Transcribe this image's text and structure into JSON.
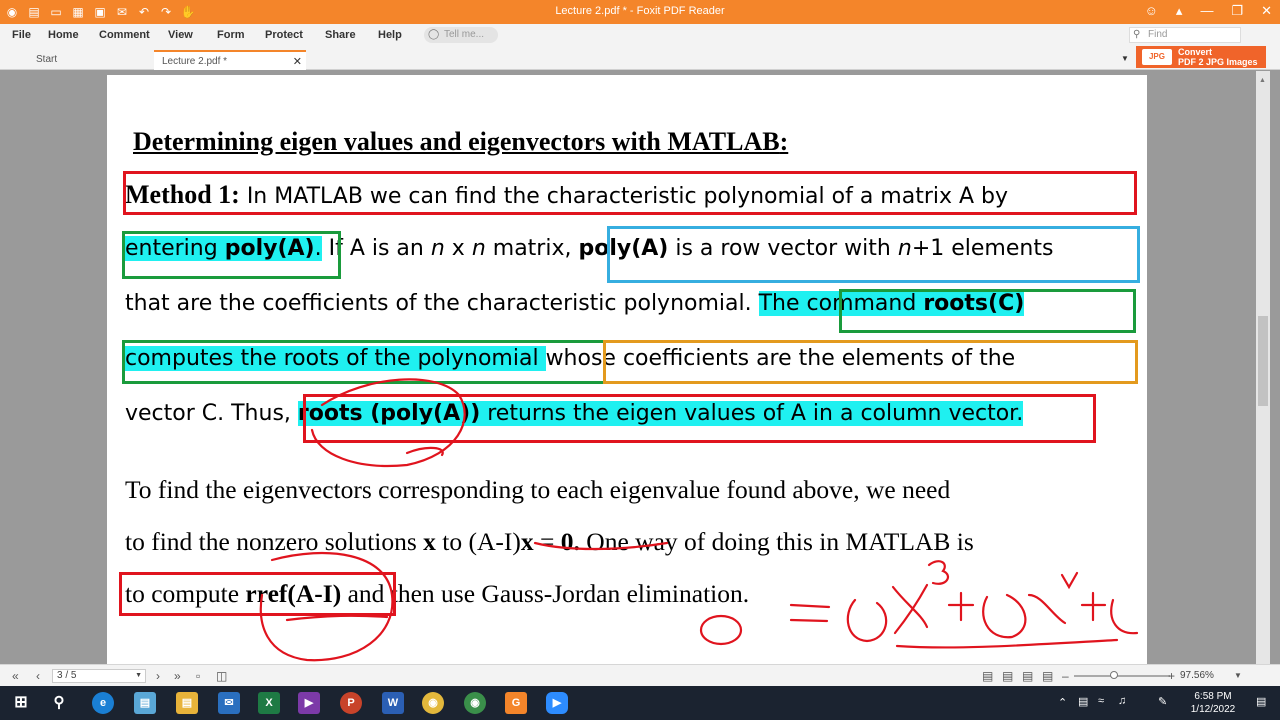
{
  "window": {
    "title": "Lecture 2.pdf * - Foxit PDF Reader"
  },
  "menu": {
    "items": [
      "File",
      "Home",
      "Comment",
      "View",
      "Form",
      "Protect",
      "Share",
      "Help"
    ],
    "tell_me": "Tell me...",
    "find": "Find"
  },
  "tabs": {
    "start": "Start",
    "doc": "Lecture 2.pdf *"
  },
  "convert": {
    "line1": "Convert",
    "line2": "PDF 2 JPG Images",
    "icon": "JPG"
  },
  "document": {
    "heading": "Determining eigen values and eigenvectors with MATLAB",
    "heading_colon": ":",
    "p1": {
      "method_label": "Method 1:",
      "l1": " In MATLAB we can find the characteristic polynomial of a matrix A by",
      "l2_a": "entering ",
      "l2_b": "poly(A)",
      "l2_c": ".",
      "l2_d": " If A is an ",
      "l2_e": "n",
      "l2_f": " x ",
      "l2_g": "n",
      "l2_h": " matrix, ",
      "l2_i": "poly(A)",
      "l2_j": " is a row vector with ",
      "l2_k": "n",
      "l2_l": "+1 elements",
      "l3_a": "that are the coefficients of the characteristic polynomial. ",
      "l3_b": "The command ",
      "l3_c": "roots(C)",
      "l4_a": "computes the roots of the polynomial ",
      "l4_b": "whose coefficients are the elements of the",
      "l5_a": "vector C. Thus, ",
      "l5_b": "roots (poly(A))",
      "l5_c": " returns the eigen values of A in a column vector."
    },
    "p2": {
      "l1": "To find the eigenvectors corresponding to each eigenvalue found above, we need",
      "l2_a": "to find the nonzero solutions ",
      "l2_b": "x",
      "l2_c": " to ",
      "l2_d": "(A-I)",
      "l2_e": "x",
      "l2_f": " = ",
      "l2_g": "0.",
      "l2_h": " One way of doing this in MATLAB is",
      "l3_a": "to compute ",
      "l3_b": "rref(A-I)",
      "l3_c": " and then use Gauss-Jordan elimination."
    }
  },
  "status": {
    "page": "3 / 5",
    "zoom": "97.56%",
    "zoom_level_fraction": 0.42
  },
  "clock": {
    "time": "6:58 PM",
    "date": "1/12/2022"
  },
  "colors": {
    "accent": "#f4852a",
    "highlight": "#1ff0f0",
    "red_box": "#e0141e",
    "green_box": "#1a9b3c",
    "blue_box": "#36aee0",
    "orange_box": "#e39a1e",
    "ink": "#e0141e"
  },
  "icons": [
    "foxit-logo-icon",
    "open-folder-icon",
    "save-icon",
    "print-icon",
    "undo-icon",
    "redo-icon",
    "hand-tool-icon",
    "account-icon",
    "minimize-icon",
    "restore-icon",
    "close-icon",
    "search-icon",
    "windows-start-icon",
    "taskbar-search-icon"
  ]
}
